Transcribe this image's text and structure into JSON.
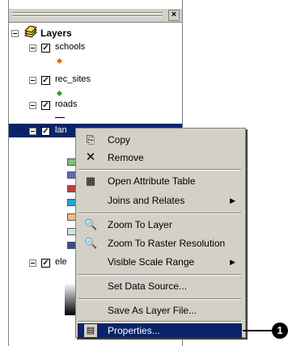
{
  "toc": {
    "close_glyph": "×",
    "root_label": "Layers",
    "layers": [
      {
        "label": "schools",
        "checked": true,
        "symbol_color": "#e46c0a"
      },
      {
        "label": "rec_sites",
        "checked": true,
        "symbol_color": "#339933"
      },
      {
        "label": "roads",
        "checked": true
      },
      {
        "label": "lan",
        "checked": true,
        "selected": true
      },
      {
        "label": "ele",
        "checked": true
      }
    ],
    "landuse_swatches": [
      "#7fbf7f",
      "#5b6bb8",
      "#c0413c",
      "#28a3d9",
      "#f5b98a",
      "#cfe6e0",
      "#3c4a8f"
    ]
  },
  "menu": {
    "items": [
      {
        "label": "Copy",
        "icon": "copy-icon"
      },
      {
        "label": "Remove",
        "icon": "remove-icon"
      },
      {
        "label": "Open Attribute Table",
        "icon": "table-icon"
      },
      {
        "label": "Joins and Relates",
        "submenu": true
      },
      {
        "label": "Zoom To Layer",
        "icon": "zoom-layer-icon"
      },
      {
        "label": "Zoom To Raster Resolution",
        "icon": "zoom-raster-icon"
      },
      {
        "label": "Visible Scale Range",
        "submenu": true
      },
      {
        "label": "Set Data Source..."
      },
      {
        "label": "Save As Layer File..."
      },
      {
        "label": "Properties...",
        "icon": "properties-icon",
        "highlighted": true
      }
    ]
  },
  "callout": {
    "number": "1"
  },
  "colors": {
    "highlight": "#0a246a",
    "menu_bg": "#d4d0c8"
  }
}
